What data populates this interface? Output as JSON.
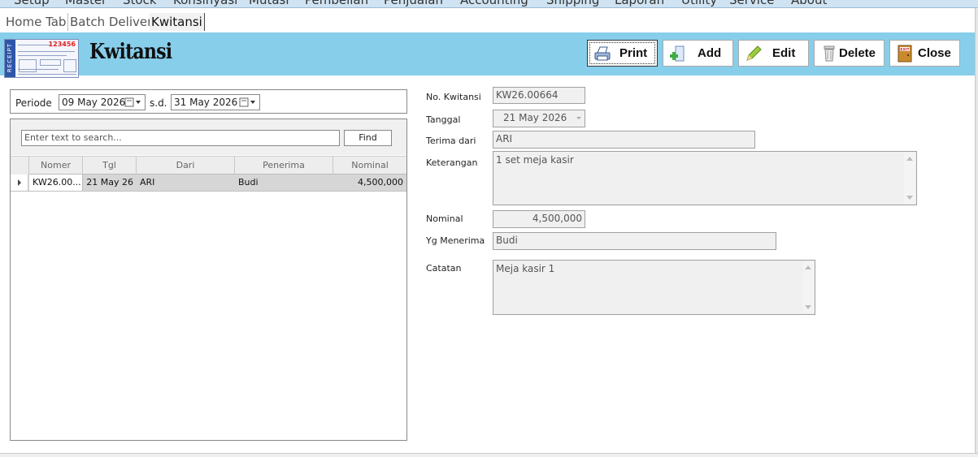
{
  "menu": [
    "Setup",
    "Master",
    "Stock",
    "Konsinyasi",
    "Mutasi",
    "Pembelian",
    "Penjualan",
    "Accounting",
    "Shipping",
    "Laporan",
    "Utility",
    "Service",
    "About"
  ],
  "tabs": [
    {
      "label": "Home Tab",
      "active": false
    },
    {
      "label": "Batch Delivery",
      "active": false
    },
    {
      "label": "Kwitansi",
      "active": true
    }
  ],
  "header": {
    "title": "Kwitansi",
    "receipt_label": "RECEIPT",
    "receipt_number": "123456",
    "background": "#87ceeb"
  },
  "toolbar": [
    {
      "id": "print",
      "label": "Print",
      "icon": "printer-icon",
      "focused": true
    },
    {
      "id": "add",
      "label": "Add",
      "icon": "add-document-icon",
      "focused": false
    },
    {
      "id": "edit",
      "label": "Edit",
      "icon": "pencil-icon",
      "focused": false
    },
    {
      "id": "delete",
      "label": "Delete",
      "icon": "trash-icon",
      "focused": false
    },
    {
      "id": "close",
      "label": "Close",
      "icon": "exit-door-icon",
      "focused": false
    }
  ],
  "filter": {
    "periode_label": "Periode",
    "from_date": "09 May 2026",
    "sd_label": "s.d.",
    "to_date": "31 May  2026"
  },
  "search": {
    "placeholder": "Enter text to search...",
    "find_label": "Find"
  },
  "grid": {
    "columns": [
      "Nomer",
      "Tgl",
      "Dari",
      "Penerima",
      "Nominal"
    ],
    "rows": [
      {
        "nomer": "KW26.00...",
        "tgl": "21 May 26",
        "dari": "ARI",
        "penerima": "Budi",
        "nominal": "4,500,000"
      }
    ]
  },
  "form": {
    "no_kwitansi": {
      "label": "No. Kwitansi",
      "value": "KW26.00664"
    },
    "tanggal": {
      "label": "Tanggal",
      "value": "21 May 2026"
    },
    "terima_dari": {
      "label": "Terima dari",
      "value": "ARI"
    },
    "keterangan": {
      "label": "Keterangan",
      "value": "1 set meja kasir"
    },
    "nominal": {
      "label": "Nominal",
      "value": "4,500,000"
    },
    "yg_menerima": {
      "label": "Yg Menerima",
      "value": "Budi"
    },
    "catatan": {
      "label": "Catatan",
      "value": "Meja kasir 1"
    }
  }
}
